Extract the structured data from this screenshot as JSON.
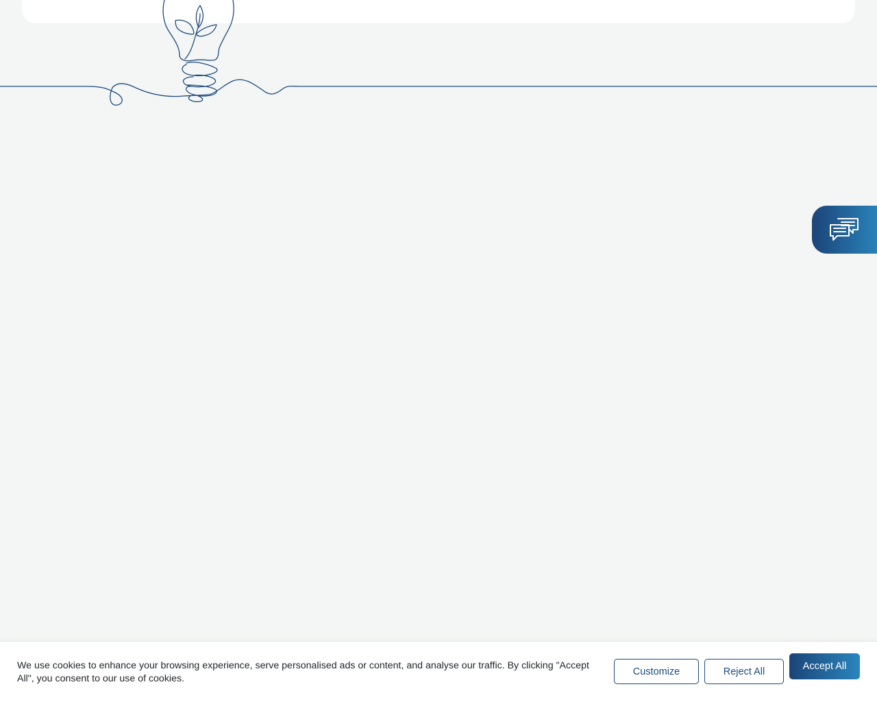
{
  "chat_widget": {
    "icon": "chat-bubbles-icon"
  },
  "illustration": {
    "icon": "lightbulb-plant-line-art"
  },
  "cookie_banner": {
    "message": "We use cookies to enhance your browsing experience, serve personalised ads or content, and analyse our traffic. By clicking \"Accept All\", you consent to our use of cookies.",
    "customize_label": "Customize",
    "reject_label": "Reject All",
    "accept_label": "Accept All"
  },
  "colors": {
    "background": "#f4f6f5",
    "accent_dark": "#1b4478",
    "accent_light": "#2a86bd",
    "line_art": "#1d4a7d"
  }
}
